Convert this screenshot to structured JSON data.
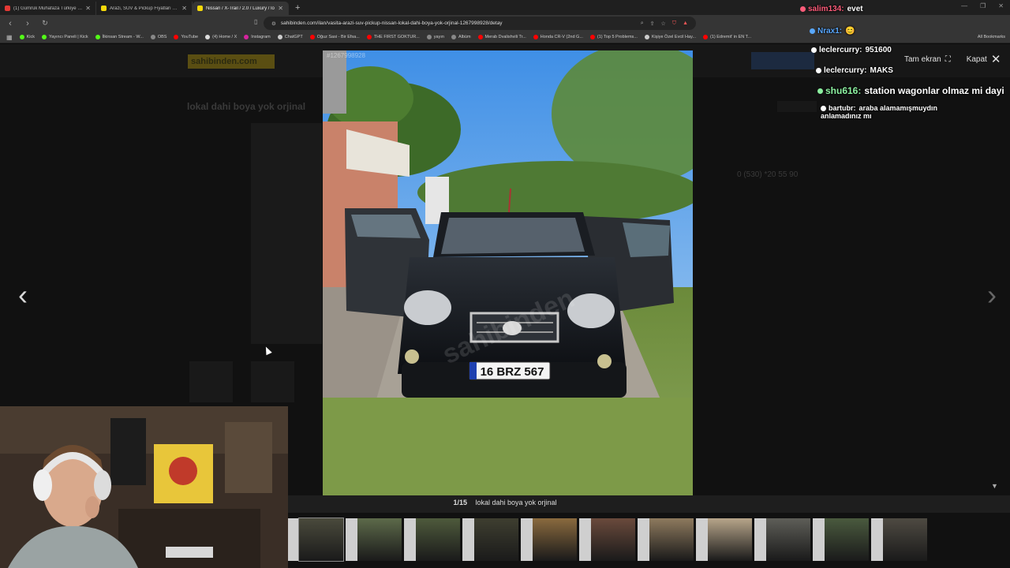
{
  "browser": {
    "tabs": [
      {
        "title": "(1) Gümrük Muhafaza Türkiye 19. Bö",
        "color": "#e53935",
        "active": false
      },
      {
        "title": "Arazi, SUV & Pickup Fiyatları & Mod",
        "color": "#f5d90a",
        "active": false
      },
      {
        "title": "Nissan / X-Trail / 2.0 / Luxury / lo",
        "color": "#f5d90a",
        "active": true
      }
    ],
    "url": "sahibinden.com/ilan/vasita-arazi-suv-pickup-nissan-lokal-dahi-boya-yok-orjinal-1267998928/detay",
    "bookmarks": [
      {
        "label": "Kick",
        "color": "#53fc18"
      },
      {
        "label": "Yayıncı Paneli | Kick",
        "color": "#53fc18"
      },
      {
        "label": "İlkinsan Stream - W...",
        "color": "#53fc18"
      },
      {
        "label": "OBS",
        "color": "#888888"
      },
      {
        "label": "YouTube",
        "color": "#ff0000"
      },
      {
        "label": "(4) Home / X",
        "color": "#dddddd"
      },
      {
        "label": "Instagram",
        "color": "#d6249f"
      },
      {
        "label": "ChatGPT",
        "color": "#cccccc"
      },
      {
        "label": "Oğuz Sasi - Bir Efsa...",
        "color": "#ff0000"
      },
      {
        "label": "THE FIRST GOKTUR...",
        "color": "#ff0000"
      },
      {
        "label": "yayın",
        "color": "#888888"
      },
      {
        "label": "Albüm",
        "color": "#888888"
      },
      {
        "label": "Merab Dvalishvili Tr...",
        "color": "#ff0000"
      },
      {
        "label": "Honda CR-V (2nd G...",
        "color": "#ff0000"
      },
      {
        "label": "(1) Top 5 Problems...",
        "color": "#ff0000"
      },
      {
        "label": "Kişiye Özel Evcil Hay...",
        "color": "#cccccc"
      },
      {
        "label": "(1) Edremit' in EN T...",
        "color": "#ff0000"
      }
    ],
    "all_bookmarks": "All Bookmarks"
  },
  "page": {
    "logo": "sahibinden.com",
    "listing_title": "lokal dahi boya yok orjinal",
    "price": "0 (530) *20 55 90"
  },
  "lightbox": {
    "ad_id": "#1267998928",
    "counter": "1/15",
    "caption": "lokal dahi boya yok orjinal",
    "fullscreen_label": "Tam ekran",
    "close_label": "Kapat",
    "plate": "16 BRZ 567",
    "watermark": "sahibinden",
    "thumb_colors": [
      "#4a4a3c",
      "#5d6a4a",
      "#4e5a3c",
      "#3e3e30",
      "#8a6a3e",
      "#6a4a3c",
      "#8e7a5e",
      "#b7a58a",
      "#5e5e58",
      "#4a5a3e",
      "#4e4a42"
    ]
  },
  "chat": [
    {
      "user": "salim134:",
      "message": "evet",
      "user_color": "#ff5c7a"
    },
    {
      "user": "Nrax1:",
      "message": "😊",
      "user_color": "#59a8ff"
    },
    {
      "user": "leclercurry:",
      "message": "951600",
      "user_color": "#ffffff"
    },
    {
      "user": "leclercurry:",
      "message": "MAKS",
      "user_color": "#ffffff"
    },
    {
      "user": "shu616:",
      "message": "station wagonlar olmaz mi dayi",
      "user_color": "#8cf0a0"
    },
    {
      "user": "bartubr:",
      "message": "araba alamamışmuydın anlamadınız mı",
      "user_color": "#ffffff"
    }
  ]
}
